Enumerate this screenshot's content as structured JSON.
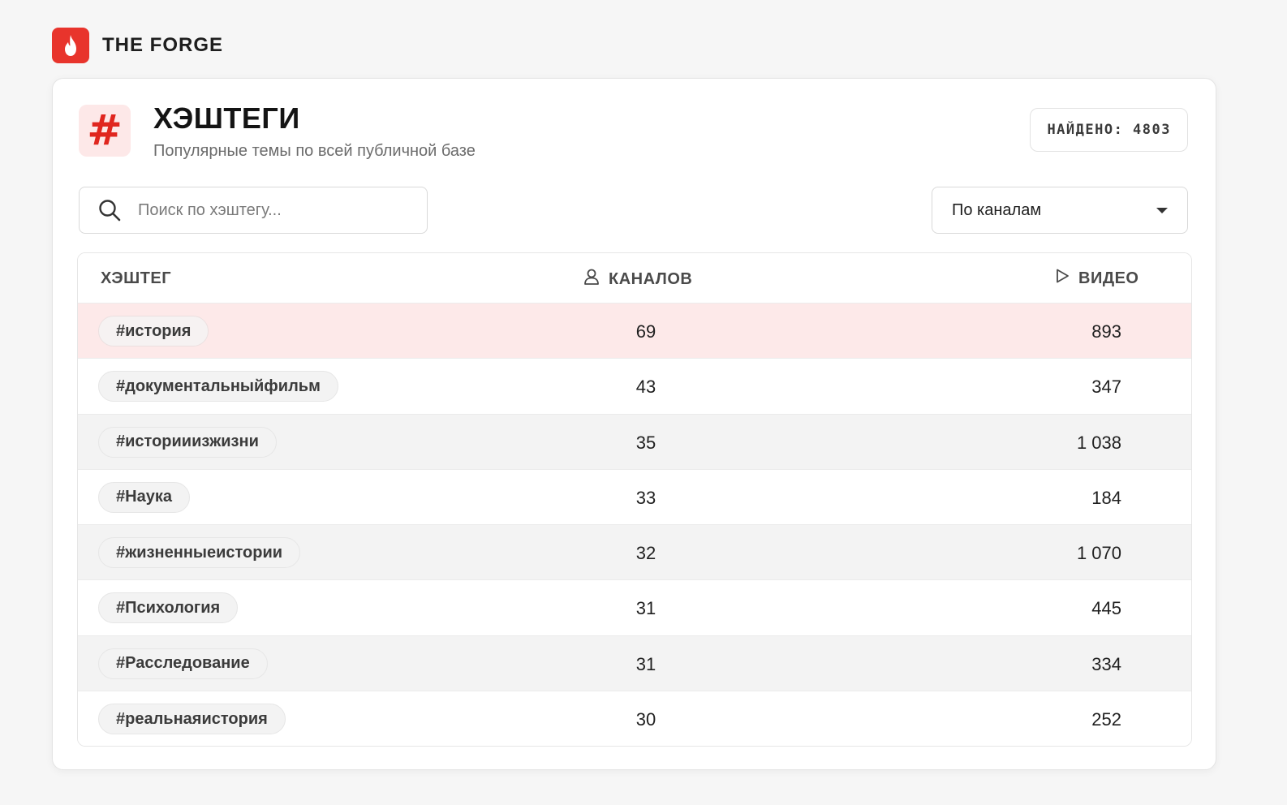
{
  "brand": {
    "name": "THE FORGE",
    "icon": "flame-icon",
    "color": "#e8342c"
  },
  "header": {
    "icon": "#",
    "title": "ХЭШТЕГИ",
    "subtitle": "Популярные темы по всей публичной базе",
    "found_label": "НАЙДЕНО: 4803"
  },
  "search": {
    "placeholder": "Поиск по хэштегу...",
    "value": ""
  },
  "sort": {
    "selected": "По каналам"
  },
  "table": {
    "columns": {
      "tag": "ХЭШТЕГ",
      "channels": "КАНАЛОВ",
      "videos": "ВИДЕО"
    },
    "rows": [
      {
        "tag": "#история",
        "channels": "69",
        "videos": "893"
      },
      {
        "tag": "#документальныйфильм",
        "channels": "43",
        "videos": "347"
      },
      {
        "tag": "#историиизжизни",
        "channels": "35",
        "videos": "1 038"
      },
      {
        "tag": "#Наука",
        "channels": "33",
        "videos": "184"
      },
      {
        "tag": "#жизненныеистории",
        "channels": "32",
        "videos": "1 070"
      },
      {
        "tag": "#Психология",
        "channels": "31",
        "videos": "445"
      },
      {
        "tag": "#Расследование",
        "channels": "31",
        "videos": "334"
      },
      {
        "tag": "#реальнаяистория",
        "channels": "30",
        "videos": "252"
      }
    ]
  },
  "colors": {
    "accent": "#e0261f",
    "highlight_row": "#fde9e9"
  }
}
